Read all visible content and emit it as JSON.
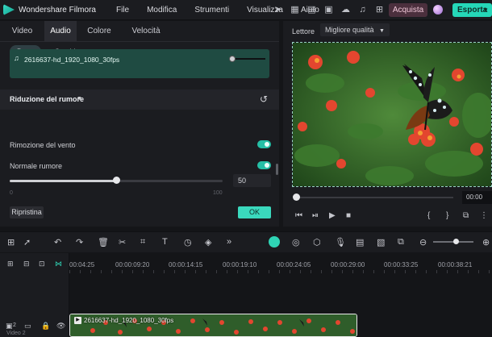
{
  "app": {
    "title": "Wondershare Filmora"
  },
  "menu": [
    "File",
    "Modifica",
    "Strumenti",
    "Visualizza",
    "Aiuto"
  ],
  "header": {
    "buy_label": "Acquista",
    "export_label": "Esporta"
  },
  "panel": {
    "tabs": [
      "Video",
      "Audio",
      "Colore",
      "Velocità"
    ],
    "active_tab": "Audio",
    "subtabs": [
      "Base",
      "Cambiavoce"
    ],
    "clip_name": "2616637-hd_1920_1080_30fps",
    "section_title": "Riduzione del rumore",
    "wind_label": "Rimozione del vento",
    "noise_label": "Normale rumore",
    "noise_value": 50,
    "slider_min": "0",
    "slider_max": "100",
    "reset_label": "Ripristina",
    "ok_label": "OK"
  },
  "preview": {
    "player_tab": "Lettore",
    "quality": "Migliore qualità",
    "timecode": "00:00"
  },
  "timeline": {
    "ruler": [
      "00:04:25",
      "00:00:09:20",
      "00:00:14:15",
      "00:00:19:10",
      "00:00:24:05",
      "00:00:29:00",
      "00:00:33:25",
      "00:00:38:21"
    ],
    "track_number": "2",
    "track_name": "Video 2",
    "clip_name": "2616637-hd_1920_1080_30fps"
  },
  "colors": {
    "accent": "#25d7b8",
    "buy": "#4b2f3d",
    "panel": "#1b1c20",
    "clip": "#1f4b42"
  }
}
